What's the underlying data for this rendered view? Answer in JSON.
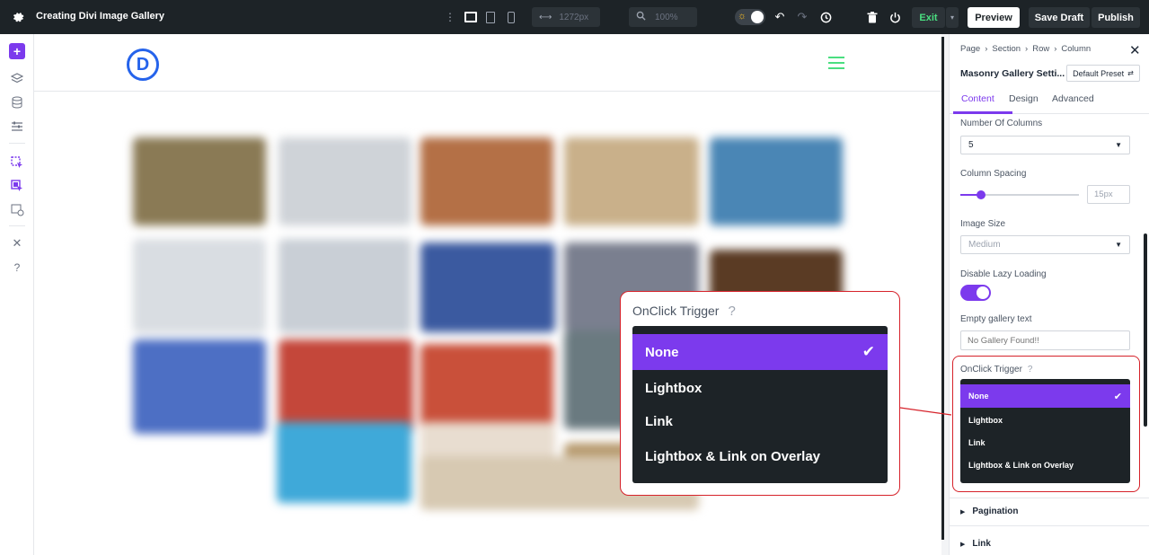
{
  "topbar": {
    "title": "Creating Divi Image Gallery",
    "width_value": "1272px",
    "zoom_value": "100%",
    "exit_label": "Exit",
    "preview_label": "Preview",
    "save_draft_label": "Save Draft",
    "publish_label": "Publish"
  },
  "canvas": {
    "logo_letter": "D"
  },
  "panel": {
    "breadcrumb": [
      "Page",
      "Section",
      "Row",
      "Column"
    ],
    "title": "Masonry Gallery Setti...",
    "preset_label": "Default Preset",
    "tabs": [
      "Content",
      "Design",
      "Advanced"
    ],
    "columns_label": "Number Of Columns",
    "columns_value": "5",
    "spacing_label": "Column Spacing",
    "spacing_value": "15px",
    "image_size_label": "Image Size",
    "image_size_value": "Medium",
    "lazy_label": "Disable Lazy Loading",
    "empty_label": "Empty gallery text",
    "empty_placeholder": "No Gallery Found!!",
    "onclick_label": "OnClick Trigger",
    "accordions": [
      "Pagination",
      "Link"
    ]
  },
  "dropdown": {
    "label": "OnClick Trigger",
    "options": [
      "None",
      "Lightbox",
      "Link",
      "Lightbox & Link on Overlay"
    ],
    "selected": "None"
  },
  "colors": {
    "accent": "#7c3aed",
    "topbar": "#1d2327",
    "highlight": "#d6222a",
    "exit": "#2e7d32"
  },
  "gallery": {
    "tile_colors": [
      "#8a7a55",
      "#cfd3d8",
      "#b47046",
      "#c9b08a",
      "#4a86b5",
      "#d9dde2",
      "#c9cfd6",
      "#3b5aa0",
      "#7a7f8f",
      "#5a3b24",
      "#4d6fc4",
      "#c4473a",
      "#c9503a",
      "#6a7a80",
      "#c9cdd2",
      "#3fa9d9",
      "#e8ddd0",
      "#b79a6e",
      "#d7c9b2"
    ]
  }
}
